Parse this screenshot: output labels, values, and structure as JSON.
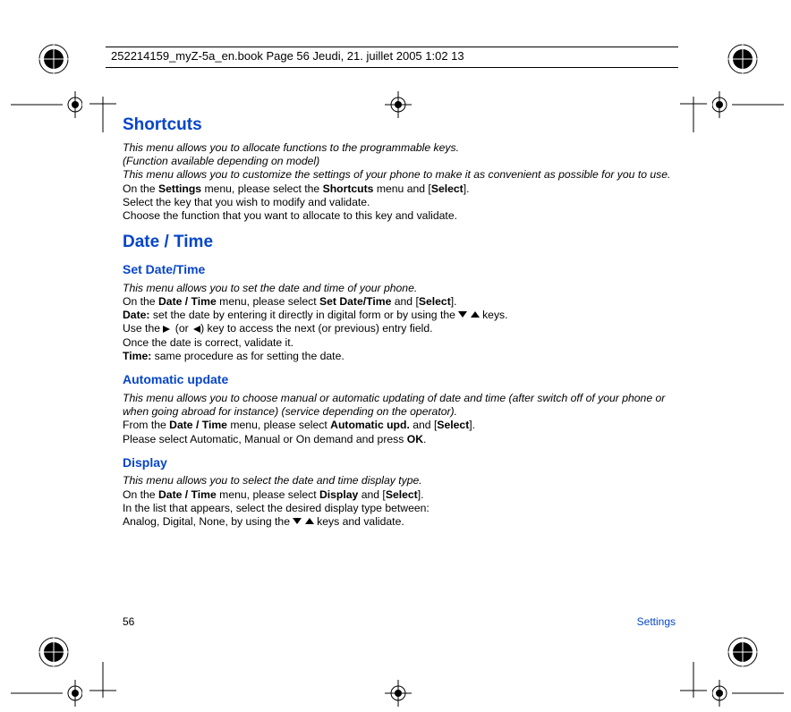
{
  "header": {
    "stamp": "252214159_myZ-5a_en.book  Page 56  Jeudi, 21. juillet 2005  1:02 13"
  },
  "page": {
    "number": "56",
    "section": "Settings"
  },
  "shortcuts": {
    "title": "Shortcuts",
    "intro1": "This menu allows you to allocate functions to the programmable keys.",
    "intro2": "(Function available depending on model)",
    "intro3": "This menu allows you to customize the settings of your phone to make it as convenient as possible for you to use.",
    "line1_a": "On the ",
    "line1_b": "Settings",
    "line1_c": " menu, please select the ",
    "line1_d": "Shortcuts",
    "line1_e": " menu and [",
    "line1_f": "Select",
    "line1_g": "].",
    "line2": "Select the key that you wish to modify and validate.",
    "line3": "Choose the function that you want to allocate to this key and validate."
  },
  "datetime": {
    "title": "Date / Time"
  },
  "setdt": {
    "title": "Set Date/Time",
    "intro": "This menu allows you to set the date and time of your phone.",
    "line1_a": "On the ",
    "line1_b": "Date / Time",
    "line1_c": " menu, please select ",
    "line1_d": "Set Date/Time",
    "line1_e": " and [",
    "line1_f": "Select",
    "line1_g": "].",
    "line2_a": "Date:",
    "line2_b": " set the date by entering it directly in digital form or by using the ",
    "line2_c": " keys.",
    "line3_a": "Use the ",
    "line3_b": " (or ",
    "line3_c": ") key to access the next (or previous) entry field.",
    "line4": "Once the date is correct, validate it.",
    "line5_a": "Time:",
    "line5_b": " same procedure as for setting the date."
  },
  "auto": {
    "title": "Automatic update",
    "intro": "This menu allows you to choose manual or automatic updating of date and time (after switch off of your phone or when going abroad for instance) (service depending on the operator).",
    "line1_a": "From the ",
    "line1_b": "Date / Time",
    "line1_c": " menu, please select ",
    "line1_d": "Automatic upd.",
    "line1_e": " and [",
    "line1_f": "Select",
    "line1_g": "].",
    "line2_a": "Please select Automatic, Manual or On demand and press ",
    "line2_b": "OK",
    "line2_c": "."
  },
  "display": {
    "title": "Display",
    "intro": "This menu allows you to select the date and time display type.",
    "line1_a": "On the ",
    "line1_b": "Date / Time",
    "line1_c": " menu, please select ",
    "line1_d": "Display",
    "line1_e": " and [",
    "line1_f": "Select",
    "line1_g": "].",
    "line2": "In the list that appears, select the desired display type between:",
    "line3_a": "Analog, Digital, None, by using the ",
    "line3_b": " keys and validate."
  }
}
